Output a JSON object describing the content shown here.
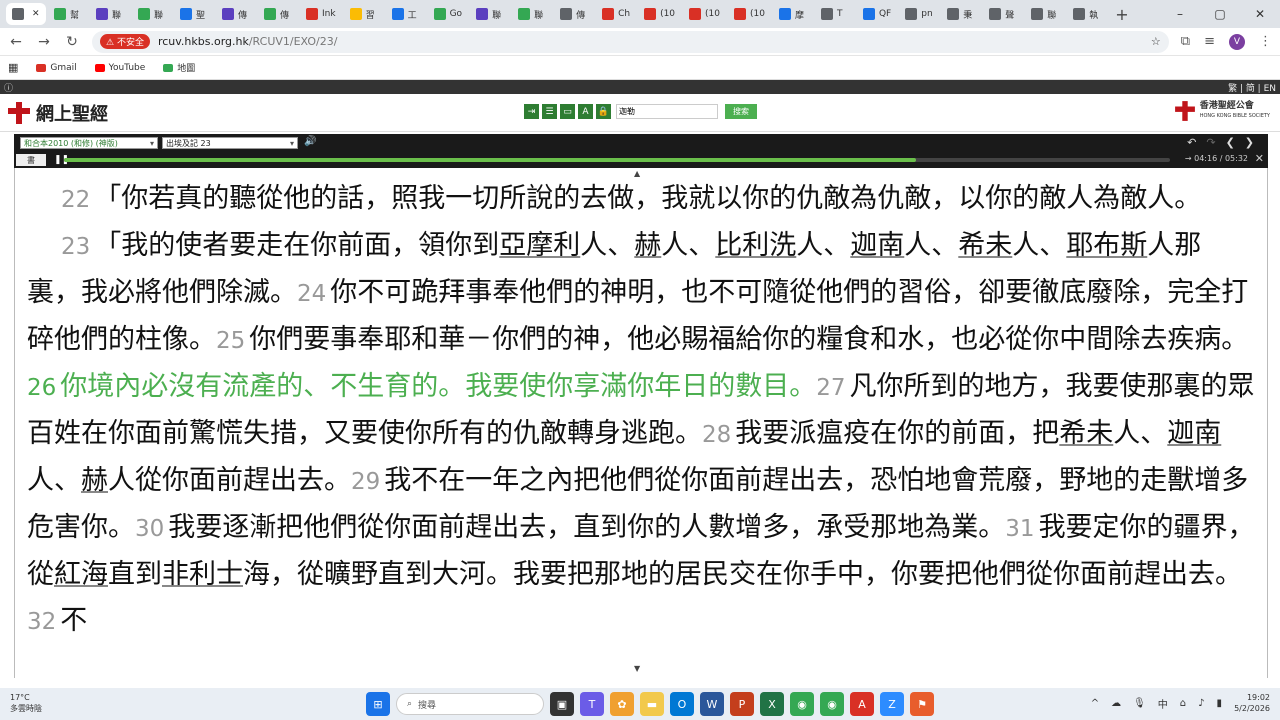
{
  "browser": {
    "tabs": [
      {
        "label": "",
        "color": "#5f6368"
      },
      {
        "label": "幫",
        "color": "#34a853"
      },
      {
        "label": "聯",
        "color": "#5b3fbf"
      },
      {
        "label": "聯",
        "color": "#34a853"
      },
      {
        "label": "聖",
        "color": "#1a73e8"
      },
      {
        "label": "傳",
        "color": "#5b3fbf"
      },
      {
        "label": "傳",
        "color": "#34a853"
      },
      {
        "label": "Ink",
        "color": "#d93025"
      },
      {
        "label": "習",
        "color": "#fbbc04"
      },
      {
        "label": "工",
        "color": "#1a73e8"
      },
      {
        "label": "Go",
        "color": "#34a853"
      },
      {
        "label": "聯",
        "color": "#5b3fbf"
      },
      {
        "label": "聯",
        "color": "#34a853"
      },
      {
        "label": "傳",
        "color": "#5f6368"
      },
      {
        "label": "Ch",
        "color": "#d93025"
      },
      {
        "label": "(10",
        "color": "#d93025"
      },
      {
        "label": "(10",
        "color": "#d93025"
      },
      {
        "label": "(10",
        "color": "#d93025"
      },
      {
        "label": "摩",
        "color": "#1a73e8"
      },
      {
        "label": "T",
        "color": "#5f6368"
      },
      {
        "label": "QF",
        "color": "#1a73e8"
      },
      {
        "label": "pn",
        "color": "#5f6368"
      },
      {
        "label": "秉",
        "color": "#5f6368"
      },
      {
        "label": "聲",
        "color": "#5f6368"
      },
      {
        "label": "聯",
        "color": "#5f6368"
      },
      {
        "label": "執",
        "color": "#5f6368"
      }
    ],
    "new_tab": "+",
    "insecure_label": "不安全",
    "url_host": "rcuv.hkbs.org.hk",
    "url_path": "/RCUV1/EXO/23/",
    "bookmarks": [
      {
        "label": "Gmail",
        "icon": "gmail-icon",
        "color": "#d93025"
      },
      {
        "label": "YouTube",
        "icon": "youtube-icon",
        "color": "#ff0000"
      },
      {
        "label": "地圖",
        "icon": "maps-icon",
        "color": "#34a853"
      }
    ],
    "avatar_letter": "V"
  },
  "site": {
    "lang": "繁 | 简 | EN",
    "logo_text": "網上聖經",
    "search_value": "迦勒",
    "search_button": "搜索",
    "society_name": "香港聖經公會",
    "society_sub": "HONG KONG BIBLE SOCIETY"
  },
  "player": {
    "version": "和合本2010 (和修) (神版)",
    "book": "出埃及記 23",
    "book_button": "書",
    "time": "04:16 / 05:32",
    "progress_fraction": 0.77
  },
  "verses": [
    {
      "paragraph": true,
      "segments": [
        {
          "type": "num",
          "text": "22"
        },
        {
          "type": "text",
          "text": "「你若真的聽從他的話，照我一切所說的去做，我就以你的仇敵為仇敵，以你的敵人為敵人。"
        }
      ]
    },
    {
      "paragraph": true,
      "segments": [
        {
          "type": "num",
          "text": "23"
        },
        {
          "type": "text",
          "text": "「我的使者要走在你前面，領你到"
        },
        {
          "type": "ul",
          "text": "亞摩利"
        },
        {
          "type": "text",
          "text": "人、"
        },
        {
          "type": "ul",
          "text": "赫"
        },
        {
          "type": "text",
          "text": "人、"
        },
        {
          "type": "ul",
          "text": "比利洗"
        },
        {
          "type": "text",
          "text": "人、"
        },
        {
          "type": "ul",
          "text": "迦南"
        },
        {
          "type": "text",
          "text": "人、"
        },
        {
          "type": "ul",
          "text": "希未"
        },
        {
          "type": "text",
          "text": "人、"
        },
        {
          "type": "ul",
          "text": "耶布斯"
        },
        {
          "type": "text",
          "text": "人那裏，我必將他們除滅。"
        },
        {
          "type": "num",
          "text": "24"
        },
        {
          "type": "text",
          "text": "你不可跪拜事奉他們的神明，也不可隨從他們的習俗，卻要徹底廢除，完全打碎他們的柱像。"
        },
        {
          "type": "num",
          "text": "25"
        },
        {
          "type": "text",
          "text": "你們要事奉耶和華－你們的神，他必賜福給你的糧食和水，也必從你中間除去疾病。"
        },
        {
          "type": "hl-num",
          "text": "26"
        },
        {
          "type": "hl",
          "text": "你境內必沒有流產的、不生育的。我要使你享滿你年日的數目。"
        },
        {
          "type": "num",
          "text": "27"
        },
        {
          "type": "text",
          "text": "凡你所到的地方，我要使那裏的眾百姓在你面前驚慌失措，又要使你所有的仇敵轉身逃跑。"
        },
        {
          "type": "num",
          "text": "28"
        },
        {
          "type": "text",
          "text": "我要派瘟疫"
        },
        {
          "type": "text",
          "text": "在你的前面，把"
        },
        {
          "type": "ul",
          "text": "希未"
        },
        {
          "type": "text",
          "text": "人、"
        },
        {
          "type": "ul",
          "text": "迦南"
        },
        {
          "type": "text",
          "text": "人、"
        },
        {
          "type": "ul",
          "text": "赫"
        },
        {
          "type": "text",
          "text": "人從你面前趕出去。"
        },
        {
          "type": "num",
          "text": "29"
        },
        {
          "type": "text",
          "text": "我不在一年之內把他們從你面前趕出去，恐怕地會荒廢，野地的走獸增多危害你。"
        },
        {
          "type": "num",
          "text": "30"
        },
        {
          "type": "text",
          "text": "我要逐漸把他們從你面前趕出去，直到你的人數增多，承受那地為業。"
        },
        {
          "type": "num",
          "text": "31"
        },
        {
          "type": "text",
          "text": "我要定你的疆界，從"
        },
        {
          "type": "ul",
          "text": "紅海"
        },
        {
          "type": "text",
          "text": "直到"
        },
        {
          "type": "ul",
          "text": "非利士"
        },
        {
          "type": "text",
          "text": "海，從曠野直到大河。我要把那地的居民交在你手中，你要把他們從你面前趕出去。"
        },
        {
          "type": "num",
          "text": "32"
        },
        {
          "type": "text",
          "text": "不"
        }
      ]
    }
  ],
  "taskbar": {
    "temp": "17°C",
    "weather": "多雲時陰",
    "search_placeholder": "搜尋",
    "ime": "中",
    "time": "19:02",
    "date": "5/2/2026"
  }
}
